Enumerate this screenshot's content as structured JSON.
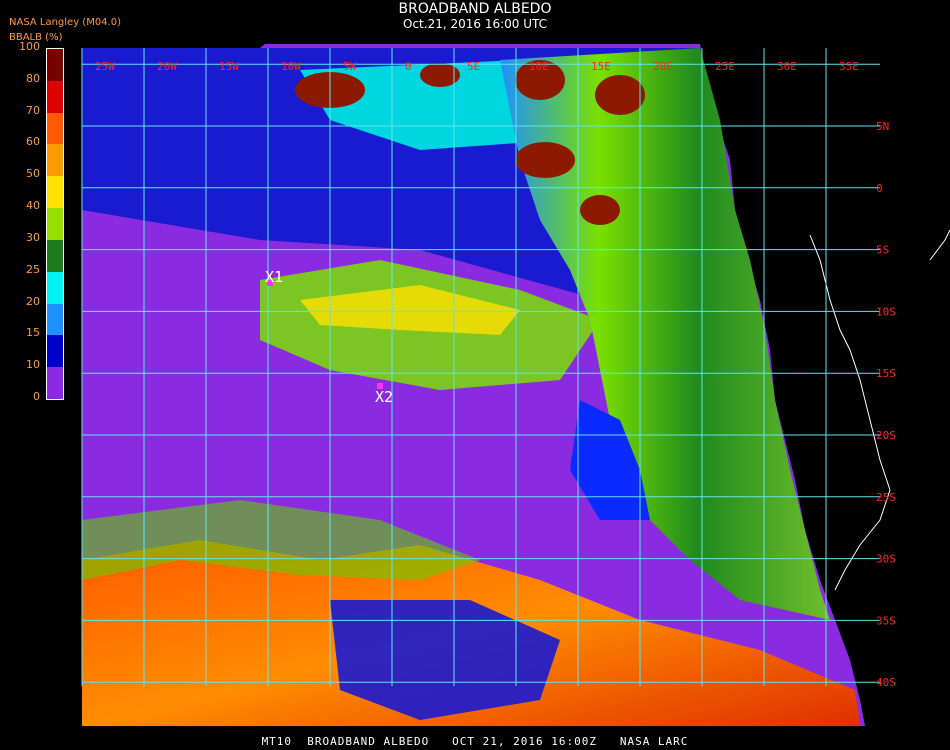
{
  "header": {
    "title": "BROADBAND ALBEDO",
    "subtitle": "Oct.21, 2016 16:00 UTC",
    "org": "NASA Langley (M04.0)",
    "colorbar_label": "BBALB (%)"
  },
  "colorbar": {
    "ticks": [
      "100",
      "80",
      "70",
      "60",
      "50",
      "40",
      "30",
      "25",
      "20",
      "15",
      "10",
      "0"
    ],
    "colors": [
      "#7a0000",
      "#e00000",
      "#ff5a00",
      "#ff9a00",
      "#ffe000",
      "#99e000",
      "#1f7a1f",
      "#00f0f0",
      "#1e90ff",
      "#0000cc",
      "#8a2be2"
    ]
  },
  "grid": {
    "lon_labels": [
      "25W",
      "20W",
      "15W",
      "10W",
      "5W",
      "0",
      "5E",
      "10E",
      "15E",
      "20E",
      "25E",
      "30E",
      "35E"
    ],
    "lat_labels": [
      "5N",
      "0",
      "5S",
      "10S",
      "15S",
      "20S",
      "25S",
      "30S",
      "35S",
      "40S"
    ]
  },
  "markers": [
    {
      "label": "X1"
    },
    {
      "label": "X2"
    }
  ],
  "footer": "MT10  BROADBAND ALBEDO   OCT 21, 2016 16:00Z   NASA LARC"
}
